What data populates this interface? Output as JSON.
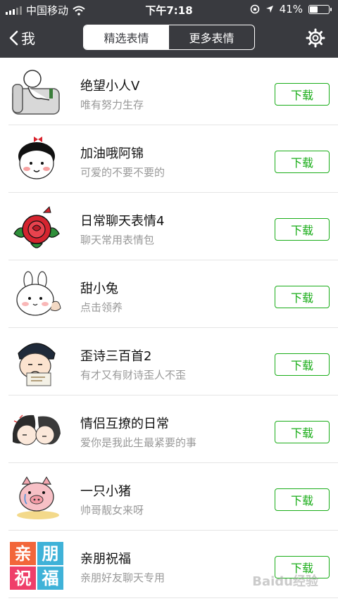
{
  "status": {
    "carrier": "中国移动",
    "time": "下午7:18",
    "battery": "41%",
    "battery_level": 0.41
  },
  "nav": {
    "back_label": "我",
    "tabs": [
      {
        "label": "精选表情",
        "active": true
      },
      {
        "label": "更多表情",
        "active": false
      }
    ]
  },
  "items": [
    {
      "title": "绝望小人V",
      "desc": "唯有努力生存",
      "button": "下载"
    },
    {
      "title": "加油哦阿锦",
      "desc": "可爱的不要不要的",
      "button": "下载"
    },
    {
      "title": "日常聊天表情4",
      "desc": "聊天常用表情包",
      "button": "下载"
    },
    {
      "title": "甜小兔",
      "desc": "点击领养",
      "button": "下载"
    },
    {
      "title": "歪诗三百首2",
      "desc": "有才又有财诗歪人不歪",
      "button": "下载"
    },
    {
      "title": "情侣互撩的日常",
      "desc": "爱你是我此生最紧要的事",
      "button": "下载"
    },
    {
      "title": "一只小猪",
      "desc": "帅哥靓女来呀",
      "button": "下载"
    },
    {
      "title": "亲朋祝福",
      "desc": "亲朋好友聊天专用",
      "button": "下载",
      "thumb_chars": [
        "亲",
        "朋",
        "祝",
        "福"
      ]
    }
  ],
  "watermark": "Baidu经验",
  "colors": {
    "bar": "#393a3f",
    "accent": "#1aad19"
  }
}
